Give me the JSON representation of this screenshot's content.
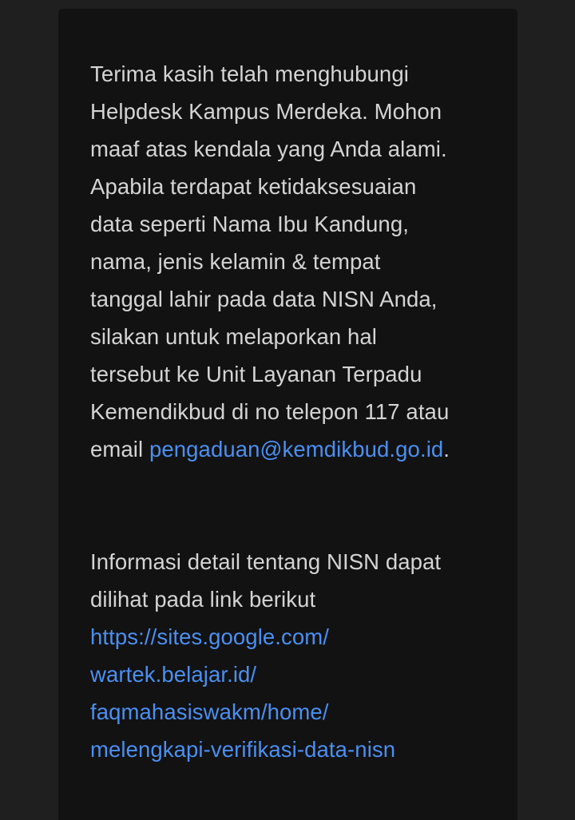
{
  "message": {
    "paragraph1": {
      "lines": [
        "Terima kasih telah menghubungi",
        "Helpdesk Kampus Merdeka. Mohon",
        "maaf atas kendala yang Anda alami.",
        "Apabila terdapat ketidaksesuaian",
        "data seperti Nama Ibu Kandung,",
        "nama, jenis kelamin & tempat",
        "tanggal lahir pada data NISN Anda,",
        "silakan untuk melaporkan hal",
        "tersebut ke Unit Layanan Terpadu",
        "Kemendikbud di no telepon 117 atau"
      ],
      "email_prefix": "email ",
      "email_link": "pengaduan@kemdikbud.go.id",
      "email_suffix": "."
    },
    "paragraph2": {
      "lines": [
        "Informasi detail tentang NISN dapat",
        "dilihat pada link berikut"
      ],
      "url_lines": [
        "https://sites.google.com/",
        "wartek.belajar.id/",
        "faqmahasiswakm/home/",
        "melengkapi-verifikasi-data-nisn"
      ]
    }
  },
  "colors": {
    "background": "#1f1f1f",
    "card": "#121212",
    "text": "#d4d4d4",
    "link": "#4b8ff2"
  }
}
